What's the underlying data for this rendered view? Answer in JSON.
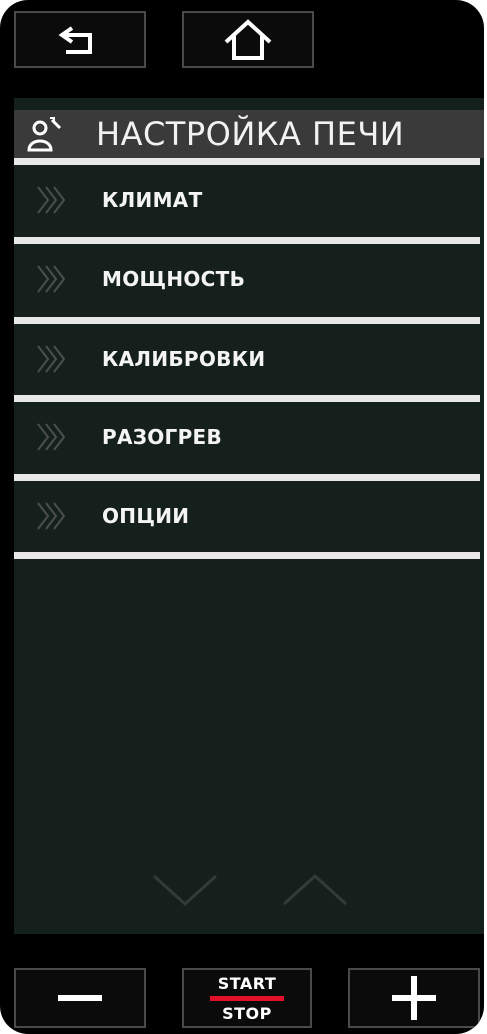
{
  "header": {
    "back_icon": "back-arrow-icon",
    "home_icon": "home-icon"
  },
  "screen": {
    "title": "НАСТРОЙКА ПЕЧИ",
    "title_icon": "user-wrench-icon",
    "menu": [
      {
        "label": "КЛИМАТ"
      },
      {
        "label": "МОЩНОСТЬ"
      },
      {
        "label": "КАЛИБРОВКИ"
      },
      {
        "label": "РАЗОГРЕВ"
      },
      {
        "label": "ОПЦИИ"
      }
    ],
    "scroll": {
      "down_icon": "chevron-down-icon",
      "up_icon": "chevron-up-icon"
    }
  },
  "footer": {
    "minus_icon": "minus-icon",
    "start_label": "START",
    "stop_label": "STOP",
    "plus_icon": "plus-icon"
  },
  "colors": {
    "background": "#000000",
    "screen": "#15201d",
    "title_bar": "#3a3a3a",
    "separator": "#e8e8e8",
    "stop_bar": "#e3102a"
  }
}
